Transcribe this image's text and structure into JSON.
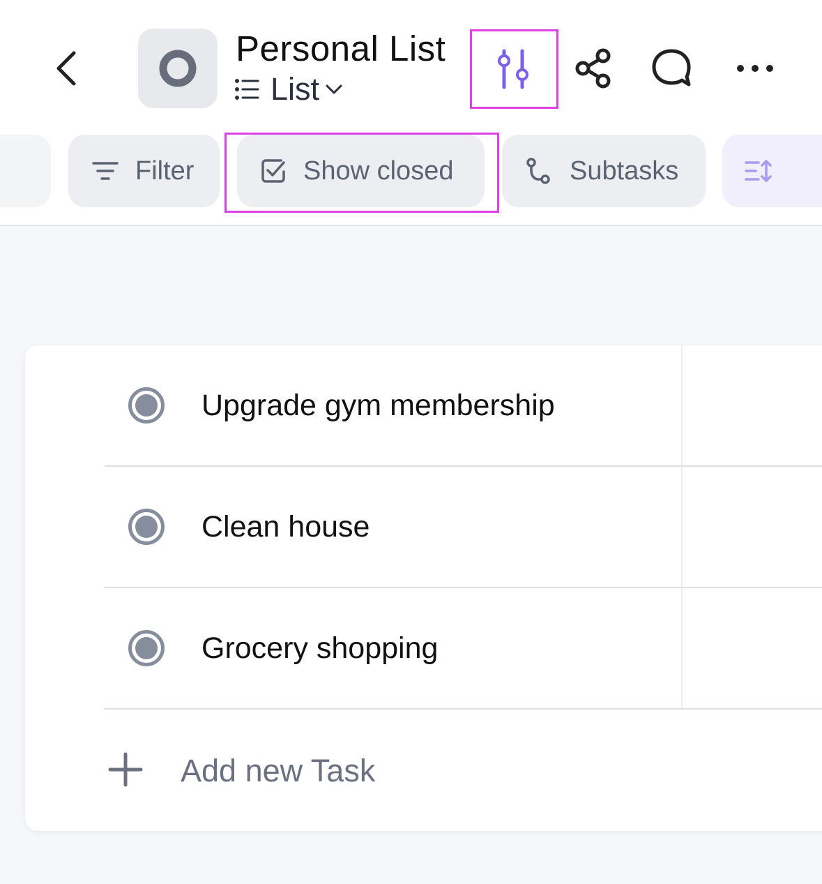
{
  "header": {
    "title": "Personal List",
    "view_label": "List"
  },
  "toolbar": {
    "filter_label": "Filter",
    "show_closed_label": "Show closed",
    "subtasks_label": "Subtasks"
  },
  "tasks": [
    {
      "name": "Upgrade gym membership"
    },
    {
      "name": "Clean house"
    },
    {
      "name": "Grocery shopping"
    }
  ],
  "add_task_label": "Add new Task",
  "colors": {
    "accent": "#7b61e8",
    "highlight": "#e040e8",
    "status_gray": "#868d9c"
  },
  "icons": [
    "chevron-left-icon",
    "list-circle-icon",
    "list-view-icon",
    "chevron-down-icon",
    "settings-sliders-icon",
    "share-icon",
    "comment-icon",
    "more-horizontal-icon",
    "filter-icon",
    "checkbox-icon",
    "subtasks-icon",
    "sort-icon",
    "plus-icon"
  ]
}
